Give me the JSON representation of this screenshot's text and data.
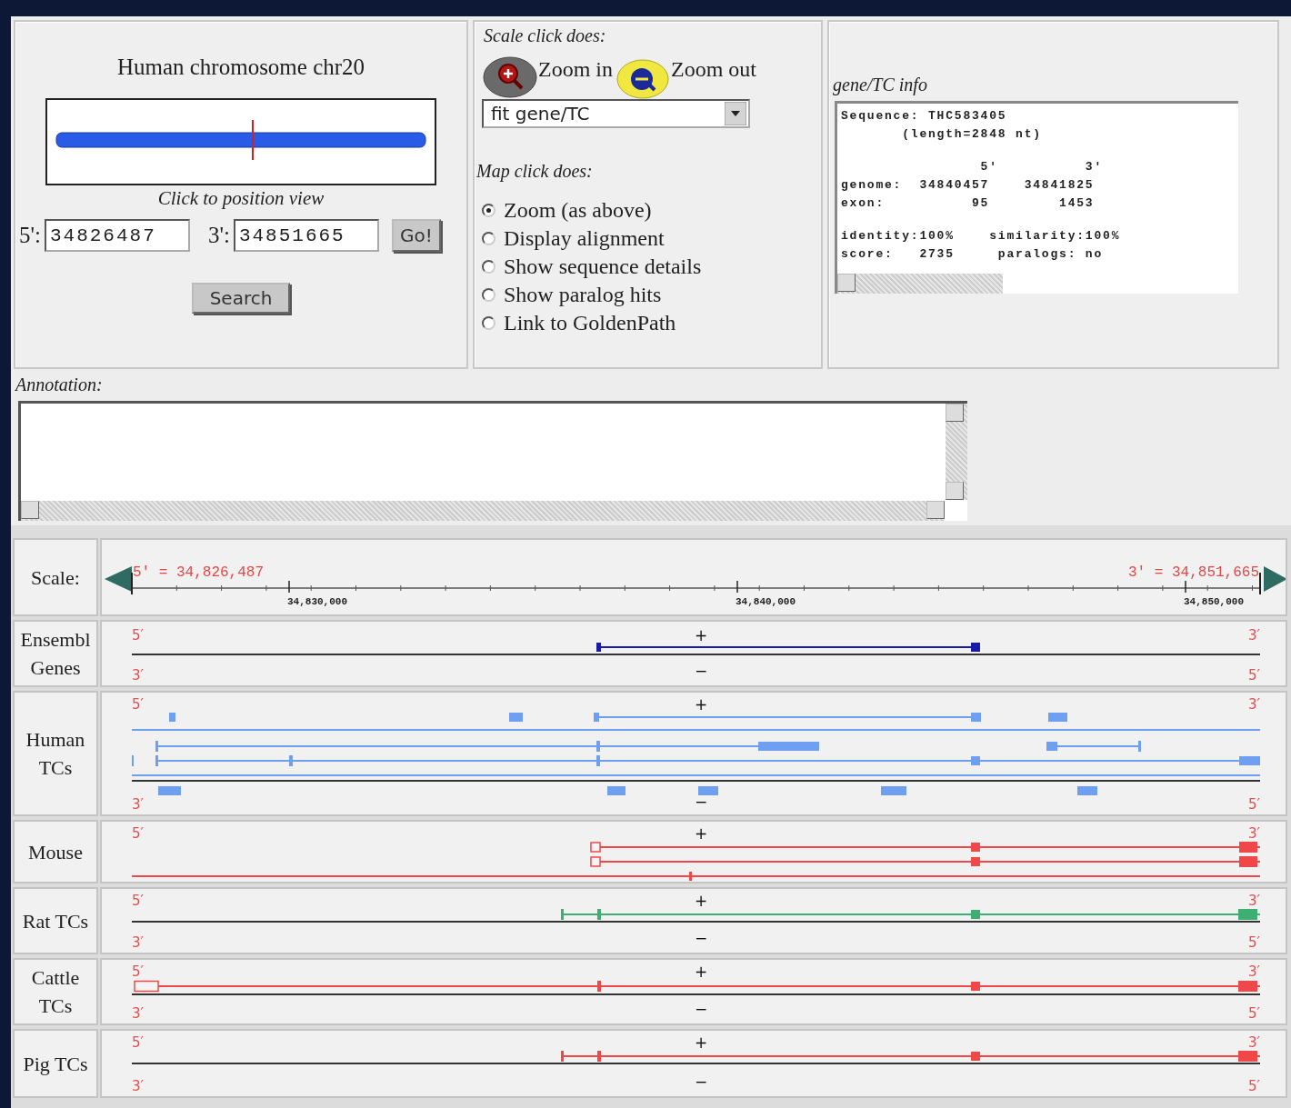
{
  "chromosome_panel": {
    "title": "Human chromosome chr20",
    "caption": "Click to position view",
    "start_label": "5':",
    "start_value": "34826487",
    "end_label": "3':",
    "end_value": "34851665",
    "go_button": "Go!",
    "search_button": "Search"
  },
  "controls_panel": {
    "scale_heading": "Scale click does:",
    "zoom_in": "Zoom in",
    "zoom_out": "Zoom out",
    "zoom_mode": "fit gene/TC",
    "map_heading": "Map click does:",
    "map_options": [
      {
        "label": "Zoom (as above)",
        "selected": true
      },
      {
        "label": "Display alignment",
        "selected": false
      },
      {
        "label": "Show sequence details",
        "selected": false
      },
      {
        "label": "Show paralog hits",
        "selected": false
      },
      {
        "label": "Link to GoldenPath",
        "selected": false
      }
    ]
  },
  "info_panel": {
    "heading": "gene/TC info",
    "blocks": [
      [
        "Sequence: THC583405",
        "       (length=2848 nt)"
      ],
      [
        "                5'          3'",
        "genome:  34840457    34841825",
        "exon:          95        1453"
      ],
      [
        "identity:100%    similarity:100%",
        "score:   2735     paralogs: no"
      ]
    ]
  },
  "annotation": {
    "label": "Annotation:"
  },
  "scale": {
    "label": "Scale:",
    "start": "5′ = 34,826,487",
    "end": "3′ = 34,851,665",
    "ticks": [
      "34,830,000",
      "34,840,000",
      "34,850,000"
    ]
  },
  "tracks": [
    {
      "label": "Ensembl Genes",
      "kind": "ensembl",
      "top_left": "5′",
      "top_right": "3′",
      "plus": "+",
      "minus": "−",
      "bottom_left": "3′",
      "bottom_right": "5′"
    },
    {
      "label": "Human TCs",
      "kind": "human",
      "top_left": "5′",
      "top_right": "3′",
      "plus": "+",
      "minus": "−",
      "bottom_left": "3′",
      "bottom_right": "5′"
    },
    {
      "label": "Mouse",
      "kind": "mouse",
      "top_left": "5′",
      "top_right": "3′",
      "plus": "+"
    },
    {
      "label": "Rat TCs",
      "kind": "rat",
      "top_left": "5′",
      "top_right": "3′",
      "plus": "+",
      "minus": "−",
      "bottom_left": "3′",
      "bottom_right": "5′"
    },
    {
      "label": "Cattle TCs",
      "kind": "cattle",
      "top_left": "5′",
      "top_right": "3′",
      "plus": "+",
      "minus": "−",
      "bottom_left": "3′",
      "bottom_right": "5′"
    },
    {
      "label": "Pig TCs",
      "kind": "pig",
      "top_left": "5′",
      "top_right": "3′",
      "plus": "+",
      "minus": "−",
      "bottom_left": "3′",
      "bottom_right": "5′"
    }
  ]
}
